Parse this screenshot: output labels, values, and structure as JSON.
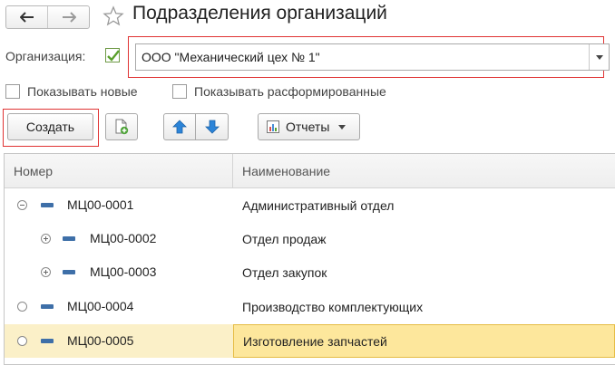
{
  "window": {
    "title": "Подразделения организаций"
  },
  "toolbar_nav": {
    "back_icon": "arrow-left-icon",
    "forward_icon": "arrow-right-icon",
    "favorite_icon": "star-icon"
  },
  "filter": {
    "org_label": "Организация:",
    "org_checked": true,
    "org_value": "ООО \"Механический цех № 1\""
  },
  "options": {
    "show_new_label": "Показывать новые",
    "show_new_checked": false,
    "show_disbanded_label": "Показывать расформированные",
    "show_disbanded_checked": false
  },
  "toolbar": {
    "create_label": "Создать",
    "copy_icon": "copy-add-icon",
    "up_icon": "arrow-up-icon",
    "down_icon": "arrow-down-icon",
    "reports_label": "Отчеты",
    "reports_icon": "report-icon"
  },
  "table": {
    "columns": [
      "Номер",
      "Наименование"
    ],
    "rows": [
      {
        "code": "МЦ00-0001",
        "name": "Административный отдел",
        "level": 0,
        "expander": "minus",
        "selected": false
      },
      {
        "code": "МЦ00-0002",
        "name": "Отдел продаж",
        "level": 1,
        "expander": "plus",
        "selected": false
      },
      {
        "code": "МЦ00-0003",
        "name": "Отдел закупок",
        "level": 1,
        "expander": "plus",
        "selected": false
      },
      {
        "code": "МЦ00-0004",
        "name": "Производство комплектующих",
        "level": 0,
        "expander": "empty",
        "selected": false
      },
      {
        "code": "МЦ00-0005",
        "name": "Изготовление запчастей",
        "level": 0,
        "expander": "empty",
        "selected": true
      }
    ]
  },
  "colors": {
    "accent_green": "#5aa02c",
    "highlight_red": "#e03333",
    "item_blue": "#3e6fa8",
    "selection": "#fde79c"
  }
}
